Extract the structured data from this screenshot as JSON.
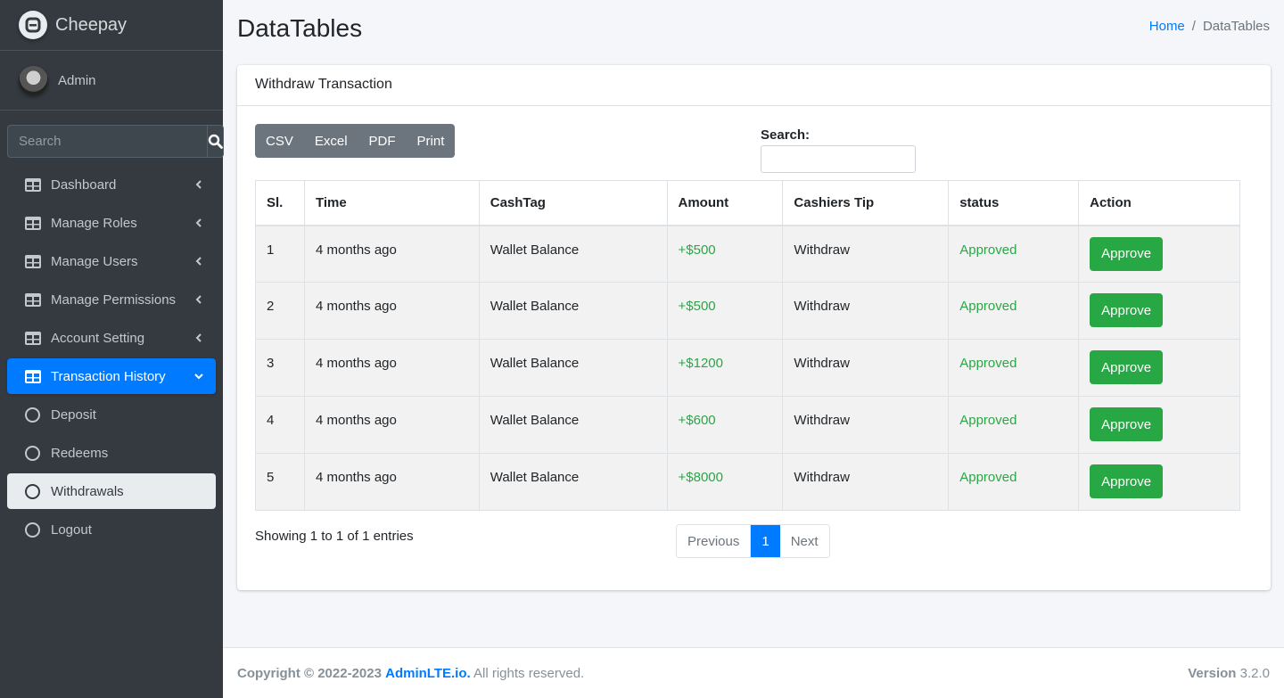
{
  "brand": {
    "name": "Cheepay"
  },
  "user": {
    "name": "Admin"
  },
  "sidebar_search": {
    "placeholder": "Search"
  },
  "nav": [
    {
      "label": "Dashboard",
      "icon": "table-icon"
    },
    {
      "label": "Manage Roles",
      "icon": "table-icon"
    },
    {
      "label": "Manage Users",
      "icon": "table-icon"
    },
    {
      "label": "Manage Permissions",
      "icon": "table-icon"
    },
    {
      "label": "Account Setting",
      "icon": "table-icon"
    },
    {
      "label": "Transaction History",
      "icon": "table-icon",
      "active": true
    },
    {
      "label": "Deposit",
      "icon": "circle-icon"
    },
    {
      "label": "Redeems",
      "icon": "circle-icon"
    },
    {
      "label": "Withdrawals",
      "icon": "circle-icon",
      "selected": true
    },
    {
      "label": "Logout",
      "icon": "circle-icon"
    }
  ],
  "page": {
    "title": "DataTables"
  },
  "breadcrumb": {
    "home": "Home",
    "separator": "/",
    "current": "DataTables"
  },
  "card": {
    "title": "Withdraw Transaction"
  },
  "export_buttons": [
    "CSV",
    "Excel",
    "PDF",
    "Print"
  ],
  "table_search": {
    "label": "Search:"
  },
  "table": {
    "columns": [
      "Sl.",
      "Time",
      "CashTag",
      "Amount",
      "Cashiers Tip",
      "status",
      "Action"
    ],
    "rows": [
      {
        "sl": "1",
        "time": "4 months ago",
        "cashtag": "Wallet Balance",
        "amount": "+$500",
        "tip": "Withdraw",
        "status": "Approved",
        "action": "Approve"
      },
      {
        "sl": "2",
        "time": "4 months ago",
        "cashtag": "Wallet Balance",
        "amount": "+$500",
        "tip": "Withdraw",
        "status": "Approved",
        "action": "Approve"
      },
      {
        "sl": "3",
        "time": "4 months ago",
        "cashtag": "Wallet Balance",
        "amount": "+$1200",
        "tip": "Withdraw",
        "status": "Approved",
        "action": "Approve"
      },
      {
        "sl": "4",
        "time": "4 months ago",
        "cashtag": "Wallet Balance",
        "amount": "+$600",
        "tip": "Withdraw",
        "status": "Approved",
        "action": "Approve"
      },
      {
        "sl": "5",
        "time": "4 months ago",
        "cashtag": "Wallet Balance",
        "amount": "+$8000",
        "tip": "Withdraw",
        "status": "Approved",
        "action": "Approve"
      }
    ]
  },
  "table_info": "Showing 1 to 1 of 1 entries",
  "pagination": {
    "previous": "Previous",
    "current": "1",
    "next": "Next"
  },
  "footer": {
    "copyright": "Copyright © 2022-2023",
    "link": "AdminLTE.io.",
    "rights": "All rights reserved.",
    "version_label": "Version",
    "version": "3.2.0"
  },
  "colors": {
    "primary": "#007bff",
    "success": "#28a745",
    "sidebar": "#343a40",
    "secondary": "#6c757d"
  }
}
